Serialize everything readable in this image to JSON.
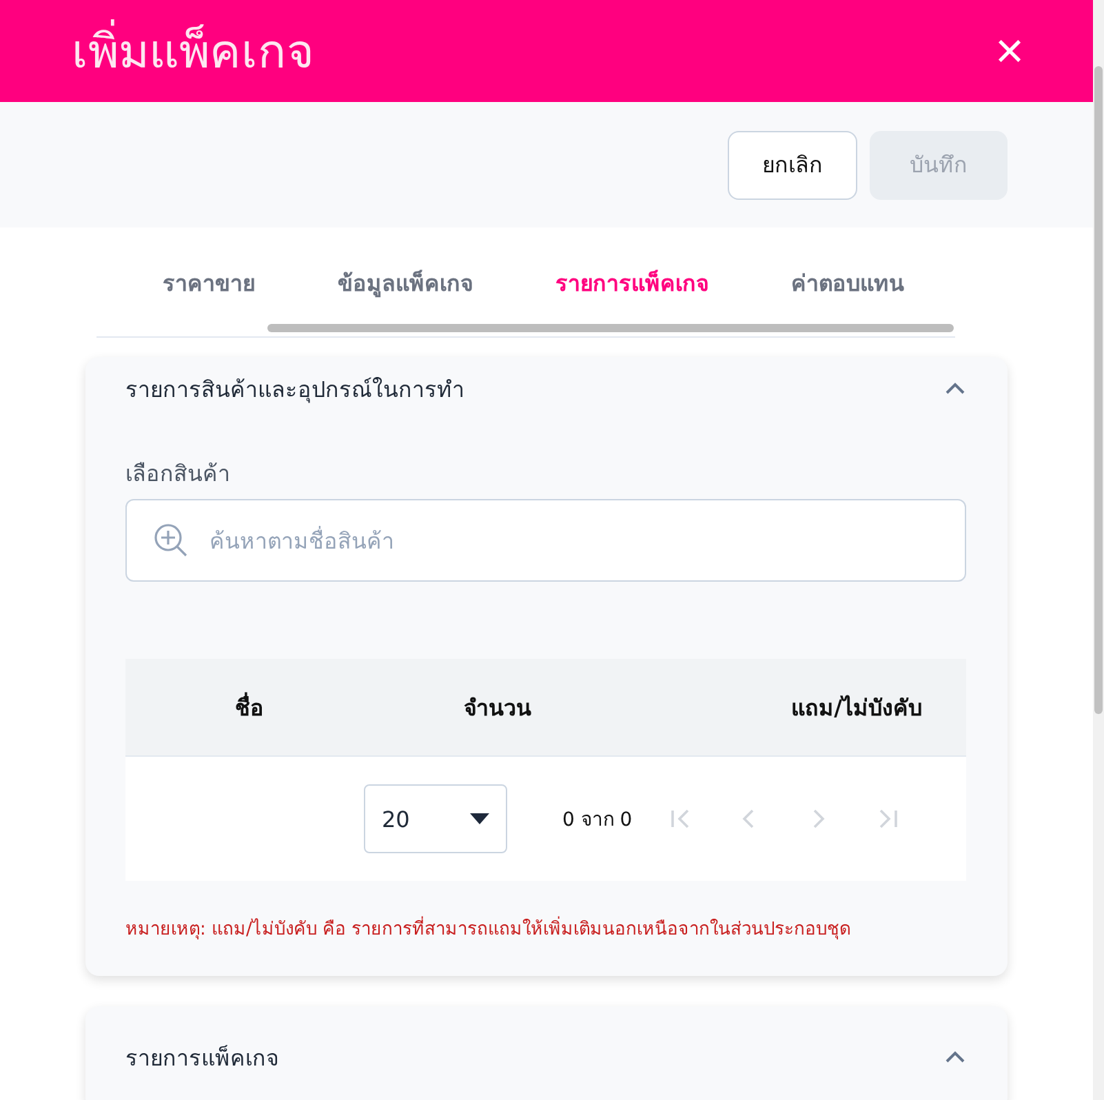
{
  "dialog": {
    "title": "เพิ่มแพ็คเกจ",
    "close_icon": "×"
  },
  "buttons": [
    {
      "label": "ยกเลิก",
      "disabled": false
    },
    {
      "label": "บันทึก",
      "disabled": true
    }
  ],
  "tabs": [
    {
      "label": "ราคาขาย",
      "selected": false
    },
    {
      "label": "ข้อมูลแพ็คเกจ",
      "selected": false
    },
    {
      "label": "รายการแพ็คเกจ",
      "selected": true
    },
    {
      "label": "ค่าตอบแทน",
      "selected": false
    }
  ],
  "sections": [
    {
      "title": "รายการสินค้าและอุปกรณ์ในการทำ",
      "expanded": true,
      "field": {
        "label": "เลือกสินค้า",
        "placeholder": "ค้นหาตามชื่อสินค้า"
      },
      "table": {
        "columns": [
          "ชื่อ",
          "จำนวน",
          "แถม/ไม่บังคับ"
        ],
        "page_size": "20",
        "range": "0 จาก 0",
        "pager": [
          {
            "kind": "first",
            "disabled": true
          },
          {
            "kind": "prev",
            "disabled": true
          },
          {
            "kind": "next",
            "disabled": true
          },
          {
            "kind": "last",
            "disabled": true
          }
        ]
      },
      "note": "หมายเหตุ: แถม/ไม่บังคับ คือ รายการที่สามารถแถมให้เพิ่มเติมนอกเหนือจากในส่วนประกอบชุด"
    },
    {
      "title": "รายการแพ็คเกจ",
      "expanded": true
    }
  ]
}
